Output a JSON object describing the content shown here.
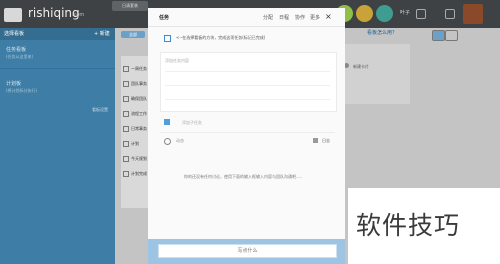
{
  "header": {
    "logo_text": "rishiqing",
    "logo_sub": ".com",
    "tab_label": "日清套装",
    "user_name": "叶子",
    "colors": {
      "bar": "#3f4244",
      "circle_green": "#8fbf49",
      "circle_gold": "#c9a23a",
      "circle_teal": "#3f9c91"
    }
  },
  "sidebar": {
    "header_title": "选择看板",
    "new_label": "+ 新建",
    "sections": [
      {
        "title": "任务看板",
        "subtitle": "(任务从这里来)"
      },
      {
        "title": "计划板",
        "subtitle": "(将计划拆分执行)",
        "right": "看板设置"
      }
    ]
  },
  "main": {
    "toolbar_label": "全部",
    "board_link": "看板怎么用？",
    "column_label": "新建卡片",
    "list_items": [
      "一周任务",
      "团队事务",
      "确保团队",
      "流程工作",
      "日常事务",
      "计划",
      "今天规划",
      "计划完成"
    ]
  },
  "task_modal": {
    "title": "任务",
    "header_links": [
      "分配",
      "日程",
      "协作",
      "更多"
    ],
    "close_icon": "close-icon",
    "task_text": "<--在选择看板的方块，完成这项任务(标记已完成)",
    "description_placeholder": "添加任务内容",
    "subtask_placeholder": "添加子任务",
    "activity_label": "动态",
    "log_label": "日志",
    "empty_note": "你的还没有任何讨论，使用下面的输入框输入内容与团队沟通吧.....",
    "comment_placeholder": "写点什么"
  },
  "watermark": {
    "text": "软件技巧"
  }
}
